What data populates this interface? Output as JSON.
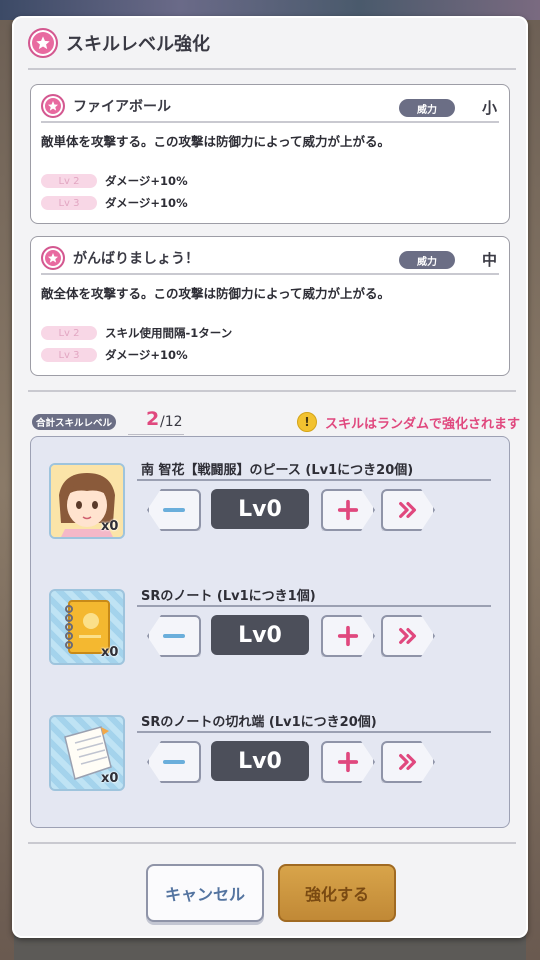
{
  "dialog": {
    "title": "スキルレベル強化"
  },
  "skills": [
    {
      "name": "ファイアボール",
      "power_label": "威力",
      "power_value": "小",
      "description": "敵単体を攻撃する。この攻撃は防御力によって威力が上がる。",
      "levels": [
        {
          "lv": "Lv 2",
          "effect": "ダメージ+10%"
        },
        {
          "lv": "Lv 3",
          "effect": "ダメージ+10%"
        }
      ]
    },
    {
      "name": "がんばりましょう！",
      "power_label": "威力",
      "power_value": "中",
      "description": "敵全体を攻撃する。この攻撃は防御力によって威力が上がる。",
      "levels": [
        {
          "lv": "Lv 2",
          "effect": "スキル使用間隔-1ターン"
        },
        {
          "lv": "Lv 3",
          "effect": "ダメージ+10%"
        }
      ]
    }
  ],
  "total": {
    "label": "合計スキルレベル",
    "current": "2",
    "max": "/12",
    "notice": "スキルはランダムで強化されます"
  },
  "materials": [
    {
      "name": "南 智花【戦闘服】のピース (Lv1につき20個)",
      "count": "x0",
      "level": "Lv0",
      "icon": "character-piece-icon"
    },
    {
      "name": "SRのノート (Lv1につき1個)",
      "count": "x0",
      "level": "Lv0",
      "icon": "notebook-icon"
    },
    {
      "name": "SRのノートの切れ端 (Lv1につき20個)",
      "count": "x0",
      "level": "Lv0",
      "icon": "note-scrap-icon"
    }
  ],
  "buttons": {
    "cancel": "キャンセル",
    "enhance": "強化する"
  },
  "colors": {
    "accent_pink": "#e0487e",
    "tag_gray": "#6b6e85",
    "enhance_gold": "#c89038"
  }
}
